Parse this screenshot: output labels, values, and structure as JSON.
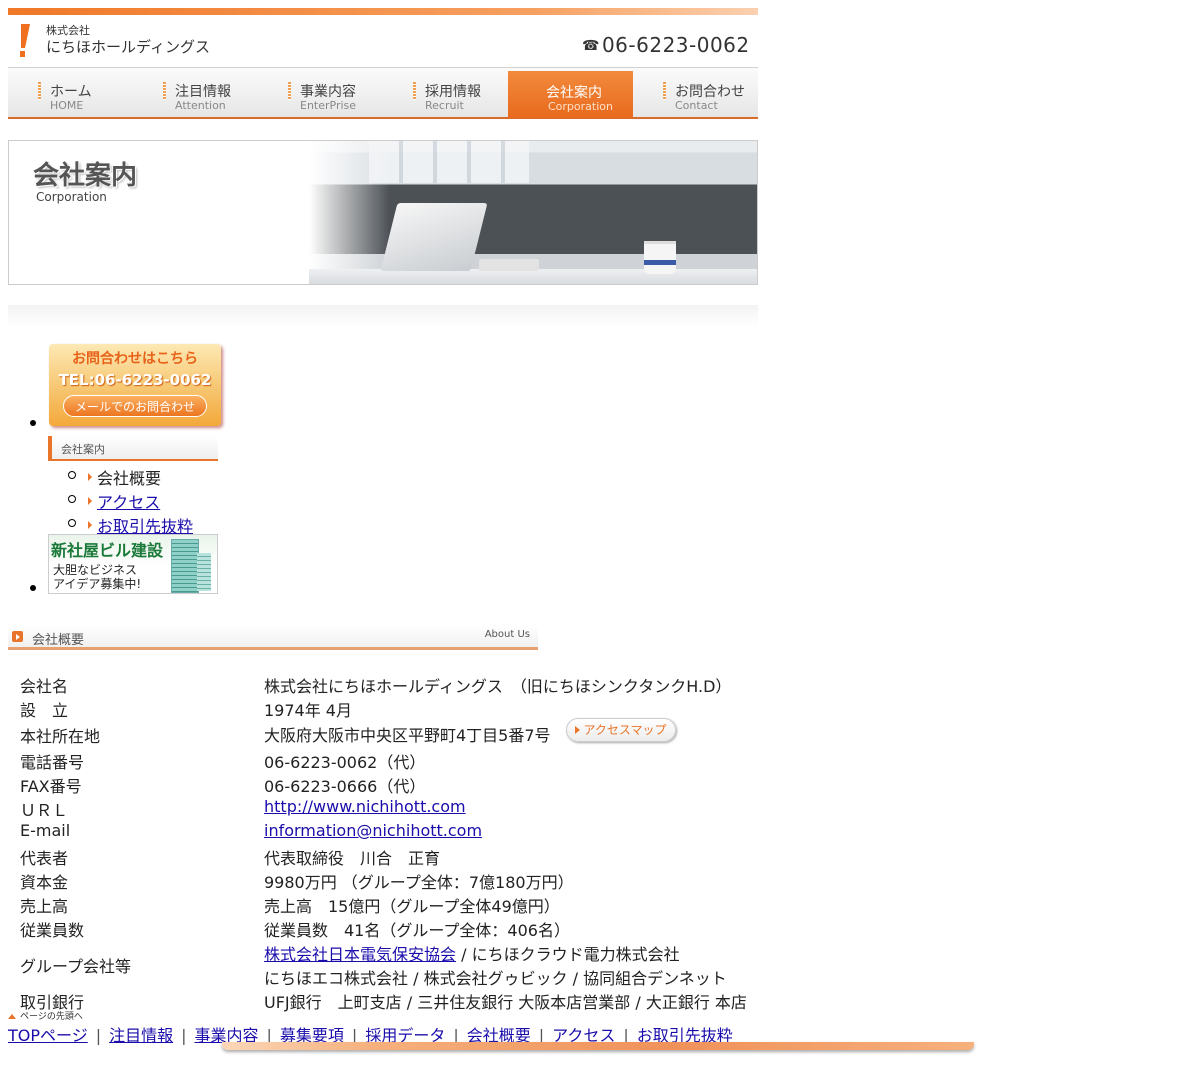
{
  "header": {
    "logo_small": "株式会社",
    "logo_main": "にちほホールディングス",
    "phone": "06-6223-0062",
    "accent_color": "#e8752a"
  },
  "nav": {
    "items": [
      {
        "jp": "ホーム",
        "en": "HOME"
      },
      {
        "jp": "注目情報",
        "en": "Attention"
      },
      {
        "jp": "事業内容",
        "en": "EnterPrise"
      },
      {
        "jp": "採用情報",
        "en": "Recruit"
      },
      {
        "jp": "会社案内",
        "en": "Corporation"
      },
      {
        "jp": "お問合わせ",
        "en": "Contact"
      }
    ],
    "active": "会社案内"
  },
  "hero": {
    "title": "会社案内",
    "subtitle": "Corporation"
  },
  "sidebar": {
    "contact": {
      "line1": "お問合わせはこちら",
      "line2": "TEL:06-6223-0062",
      "mail_button": "メールでのお問合わせ"
    },
    "section_title": "会社案内",
    "links": [
      {
        "label": "会社概要"
      },
      {
        "label": "アクセス"
      },
      {
        "label": "お取引先抜粋"
      }
    ],
    "banner": {
      "title": "新社屋ビル建設",
      "line1": "大胆なビジネス",
      "line2": "アイデア募集中!"
    }
  },
  "about": {
    "heading": "会社概要",
    "heading_en": "About Us",
    "access_button": "アクセスマップ",
    "rows": [
      {
        "label": "会社名",
        "value": "株式会社にちほホールディングス　（旧にちほシンクタンクH.D）"
      },
      {
        "label": "設　立",
        "value": "1974年 4月"
      },
      {
        "label": "本社所在地",
        "value": "大阪府大阪市中央区平野町4丁目5番7号"
      },
      {
        "label": "電話番号",
        "value": "06-6223-0062（代）"
      },
      {
        "label": "FAX番号",
        "value": "06-6223-0666（代）"
      },
      {
        "label": "ＵＲＬ",
        "value": "http://www.nichihott.com"
      },
      {
        "label": "E-mail",
        "value": "information@nichihott.com"
      },
      {
        "label": "代表者",
        "value": "代表取締役　川合　正育"
      },
      {
        "label": "資本金",
        "value": "9980万円 （グループ全体：7億180万円）"
      },
      {
        "label": "売上高",
        "value": "売上高　15億円（グループ全体49億円）"
      },
      {
        "label": "従業員数",
        "value": "従業員数　41名（グループ全体：406名）"
      },
      {
        "label": "グループ会社等",
        "value_link": "株式会社日本電気保安協会",
        "value_rest": " / にちほクラウド電力株式会社",
        "value_line2": "にちほエコ株式会社 / 株式会社グゥビック / 協同組合デンネット"
      },
      {
        "label": "取引銀行",
        "value": "UFJ銀行　上町支店 / 三井住友銀行 大阪本店営業部 / 大正銀行 本店"
      }
    ]
  },
  "footer": {
    "page_top": "ページの先頭へ",
    "links": [
      "TOPページ",
      "注目情報",
      "事業内容",
      "募集要項",
      "採用データ",
      "会社概要",
      "アクセス",
      "お取引先抜粋"
    ],
    "separator": "|"
  }
}
